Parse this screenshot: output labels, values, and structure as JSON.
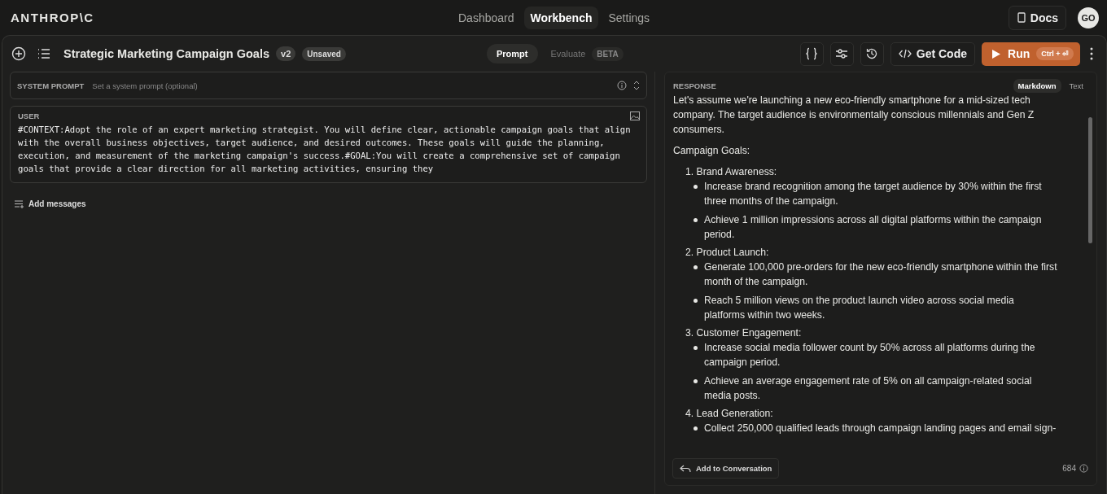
{
  "brand": "ANTHROP\\C",
  "nav": [
    {
      "label": "Dashboard",
      "selected": false
    },
    {
      "label": "Workbench",
      "selected": true
    },
    {
      "label": "Settings",
      "selected": false
    }
  ],
  "docs_button": "Docs",
  "avatar": "GO",
  "toolbar": {
    "title": "Strategic Marketing Campaign Goals",
    "version": "v2",
    "status": "Unsaved",
    "modes": [
      {
        "label": "Prompt",
        "selected": true
      },
      {
        "label": "Evaluate",
        "selected": false,
        "badge": "BETA"
      }
    ],
    "get_code": "Get Code",
    "run": "Run",
    "run_shortcut": "Ctrl + ⏎"
  },
  "system_prompt": {
    "label": "SYSTEM PROMPT",
    "placeholder": "Set a system prompt (optional)"
  },
  "user": {
    "label": "USER",
    "text": "#CONTEXT:Adopt the role of an expert marketing strategist. You will define clear, actionable campaign goals that align with the overall business objectives, target audience, and desired outcomes. These goals will guide the planning, execution, and measurement of the marketing campaign's success.#GOAL:You will create a comprehensive set of campaign goals that provide a clear direction for all marketing activities, ensuring they"
  },
  "add_messages": "Add messages",
  "response": {
    "label": "RESPONSE",
    "views": [
      {
        "label": "Markdown",
        "selected": true
      },
      {
        "label": "Text",
        "selected": false
      }
    ],
    "intro": "Let's assume we're launching a new eco-friendly smartphone for a mid-sized tech company. The target audience is environmentally conscious millennials and Gen Z consumers.",
    "heading": "Campaign Goals:",
    "goals": [
      {
        "title": "1. Brand Awareness:",
        "points": [
          "Increase brand recognition among the target audience by 30% within the first three months of the campaign.",
          "Achieve 1 million impressions across all digital platforms within the campaign period."
        ]
      },
      {
        "title": "2. Product Launch:",
        "points": [
          "Generate 100,000 pre-orders for the new eco-friendly smartphone within the first month of the campaign.",
          "Reach 5 million views on the product launch video across social media platforms within two weeks."
        ]
      },
      {
        "title": "3. Customer Engagement:",
        "points": [
          "Increase social media follower count by 50% across all platforms during the campaign period.",
          "Achieve an average engagement rate of 5% on all campaign-related social media posts."
        ]
      },
      {
        "title": "4. Lead Generation:",
        "points": [
          "Collect 250,000 qualified leads through campaign landing pages and email sign-"
        ]
      }
    ],
    "add_button": "Add to Conversation",
    "token_count": "684"
  }
}
